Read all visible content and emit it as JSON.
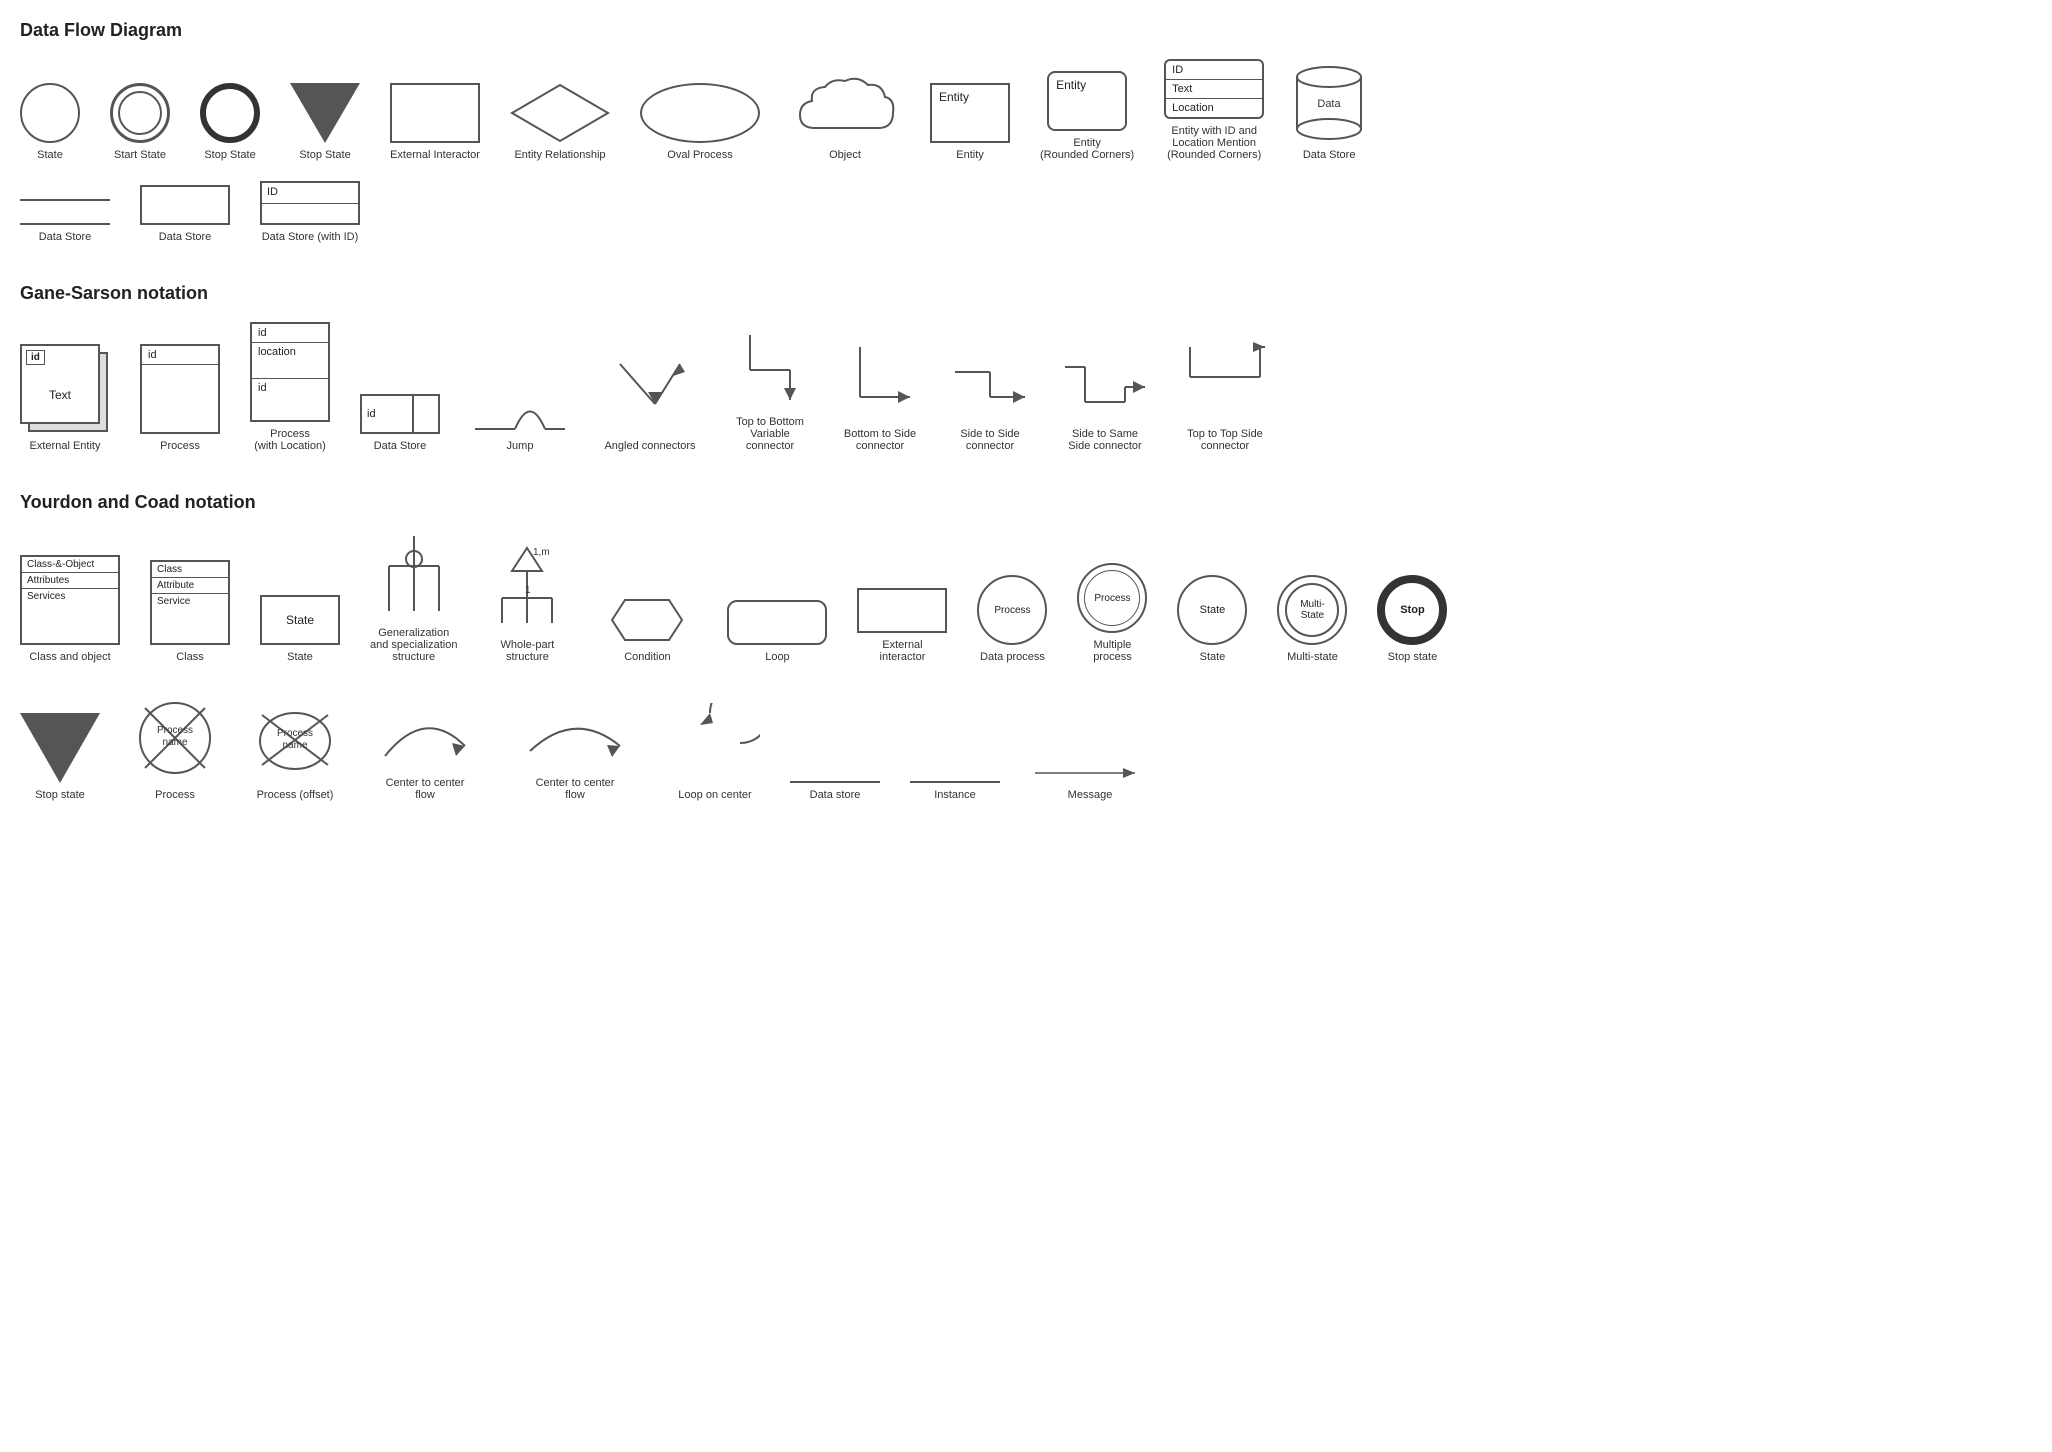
{
  "sections": {
    "dfd": {
      "title": "Data Flow Diagram",
      "shapes": [
        {
          "id": "state",
          "label": "State"
        },
        {
          "id": "start-state",
          "label": "Start State"
        },
        {
          "id": "stop-state-thick",
          "label": "Stop State"
        },
        {
          "id": "stop-state-triangle",
          "label": "Stop State"
        },
        {
          "id": "external-interactor",
          "label": "External Interactor"
        },
        {
          "id": "entity-relationship",
          "label": "Entity Relationship"
        },
        {
          "id": "oval-process",
          "label": "Oval Process"
        },
        {
          "id": "object",
          "label": "Object"
        },
        {
          "id": "entity",
          "label": "Entity"
        },
        {
          "id": "entity-rounded",
          "label": "Entity\n(Rounded Corners)"
        },
        {
          "id": "entity-id",
          "label": "Entity with ID and\nLocation Mention\n(Rounded Corners)"
        },
        {
          "id": "data-store-cylinder",
          "label": "Data Store"
        }
      ],
      "row2": [
        {
          "id": "ds-lines",
          "label": "Data Store"
        },
        {
          "id": "ds-box",
          "label": "Data Store"
        },
        {
          "id": "ds-id-box",
          "label": "Data Store (with ID)"
        }
      ]
    },
    "gane": {
      "title": "Gane-Sarson notation",
      "shapes": [
        {
          "id": "gs-ext",
          "label": "External Entity"
        },
        {
          "id": "gs-process",
          "label": "Process"
        },
        {
          "id": "gs-process-loc",
          "label": "Process\n(with Location)"
        },
        {
          "id": "gs-datastore",
          "label": "Data Store"
        },
        {
          "id": "gs-jump",
          "label": "Jump"
        },
        {
          "id": "gs-angled",
          "label": "Angled connectors"
        },
        {
          "id": "gs-top-bottom",
          "label": "Top to Bottom\nVariable\nconnector"
        },
        {
          "id": "gs-bottom-side",
          "label": "Bottom to Side\nconnector"
        },
        {
          "id": "gs-side-side",
          "label": "Side to Side\nconnector"
        },
        {
          "id": "gs-side-same",
          "label": "Side to Same\nSide connector"
        },
        {
          "id": "gs-top-top",
          "label": "Top to Top Side\nconnector"
        }
      ]
    },
    "yourdon": {
      "title": "Yourdon and Coad notation",
      "row1": [
        {
          "id": "yc-class-obj",
          "label": "Class and object"
        },
        {
          "id": "yc-class",
          "label": "Class"
        },
        {
          "id": "yc-state",
          "label": "State"
        },
        {
          "id": "yc-gen-spec",
          "label": "Generalization\nand specialization\nstructure"
        },
        {
          "id": "yc-whole-part",
          "label": "Whole-part\nstructure"
        },
        {
          "id": "yc-condition",
          "label": "Condition"
        },
        {
          "id": "yc-loop",
          "label": "Loop"
        },
        {
          "id": "yc-ext-int",
          "label": "External\ninteractor"
        },
        {
          "id": "yc-data-proc",
          "label": "Data process"
        },
        {
          "id": "yc-multi-proc",
          "label": "Multiple\nprocess"
        },
        {
          "id": "yc-state-c",
          "label": "State"
        },
        {
          "id": "yc-multistate",
          "label": "Multi-state"
        },
        {
          "id": "yc-stop",
          "label": "Stop state"
        }
      ],
      "row2": [
        {
          "id": "yc-stop-tri",
          "label": "Stop state"
        },
        {
          "id": "yc-proc-cross",
          "label": "Process"
        },
        {
          "id": "yc-proc-offset",
          "label": "Process (offset)"
        },
        {
          "id": "yc-c2c1",
          "label": "Center to center\nflow"
        },
        {
          "id": "yc-c2c2",
          "label": "Center to center\nflow"
        },
        {
          "id": "yc-loop-center",
          "label": "Loop on center"
        },
        {
          "id": "yc-datastore",
          "label": "Data store"
        },
        {
          "id": "yc-instance",
          "label": "Instance"
        },
        {
          "id": "yc-message",
          "label": "Message"
        }
      ]
    }
  },
  "labels": {
    "state": "State",
    "start_state": "Start State",
    "stop_state_thick": "Stop State",
    "stop_state_tri": "Stop State",
    "external_interactor": "External Interactor",
    "entity_relationship": "Entity Relationship",
    "oval_process": "Oval Process",
    "object": "Object",
    "entity": "Entity",
    "entity_rounded": "Entity\n(Rounded Corners)",
    "entity_id": "Entity with ID and Location Mention (Rounded Corners)",
    "data_store_cyl": "Data Store",
    "ds_lines": "Data Store",
    "ds_box": "Data Store",
    "ds_id": "Data Store (with ID)",
    "gs_ext": "External Entity",
    "gs_process": "Process",
    "gs_process_loc": "Process\n(with Location)",
    "gs_ds": "Data Store",
    "gs_jump": "Jump",
    "gs_angled": "Angled connectors",
    "gs_top_bottom": "Top to Bottom Variable connector",
    "gs_bottom_side": "Bottom to Side connector",
    "gs_side_side": "Side to Side connector",
    "gs_side_same": "Side to Same Side connector",
    "gs_top_top": "Top to Top Side connector",
    "yc_class_obj": "Class and object",
    "yc_class": "Class",
    "yc_state": "State",
    "yc_gen_spec": "Generalization and specialization structure",
    "yc_whole_part": "Whole-part structure",
    "yc_condition": "Condition",
    "yc_loop": "Loop",
    "yc_ext_int": "External interactor",
    "yc_data_proc": "Data process",
    "yc_multi_proc": "Multiple process",
    "yc_state_c": "State",
    "yc_multistate": "Multi-state",
    "yc_stop": "Stop state",
    "yc_stop_tri": "Stop state",
    "yc_proc_cross": "Process",
    "yc_proc_offset": "Process (offset)",
    "yc_c2c1": "Center to center flow",
    "yc_c2c2": "Center to center flow",
    "yc_loop_center": "Loop on center",
    "yc_datastore": "Data store",
    "yc_instance": "Instance",
    "yc_message": "Message",
    "entity_text": "Entity",
    "id_text": "ID",
    "text_text": "Text",
    "location_text": "Location",
    "data_text": "Data",
    "id_badge": "id",
    "process_text": "Process",
    "state_text": "State",
    "class_text": "Class",
    "attribute_text": "Attribute",
    "service_text": "Service",
    "class_obj_row1": "Class-&-Object",
    "class_obj_row2": "Attributes",
    "class_obj_row3": "Services",
    "one_m": "1,m",
    "one": "1",
    "multi_state_text": "Multi-\nState",
    "stop_text": "Stop",
    "process_name": "Process name",
    "process_name2": "Process\nname"
  }
}
